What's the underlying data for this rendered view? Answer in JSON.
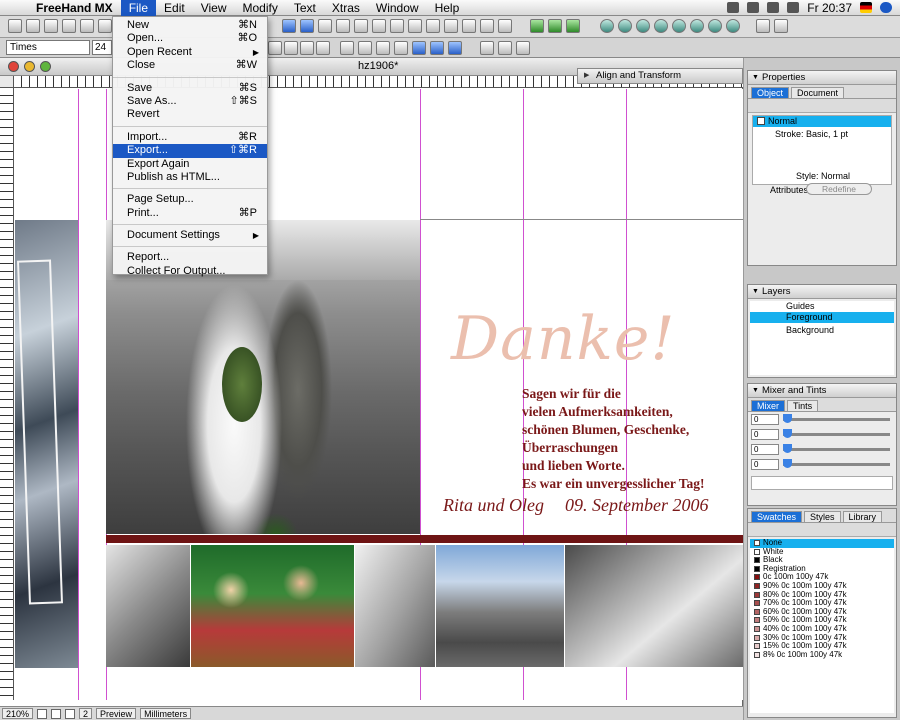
{
  "menubar": {
    "app_name": "FreeHand MX",
    "items": [
      "File",
      "Edit",
      "View",
      "Modify",
      "Text",
      "Xtras",
      "Window",
      "Help"
    ],
    "clock": "Fr 20:37"
  },
  "toolbar": {
    "font": "Times",
    "font_size": "24"
  },
  "document": {
    "title": "hz1906*",
    "zoom": "210%",
    "page": "2",
    "view_mode": "Preview",
    "units": "Millimeters"
  },
  "artwork": {
    "headline": "Danke!",
    "message_lines": [
      "Sagen wir für die",
      "vielen Aufmerksamkeiten,",
      "schönen Blumen, Geschenke,",
      "Überraschungen",
      "und lieben Worte.",
      "Es war ein unvergesslicher Tag!"
    ],
    "signature": "Rita und Oleg",
    "date": "09. September 2006",
    "text_color": "#7a1818",
    "headline_color": "#ebbfae",
    "guide_color": "#d050d0"
  },
  "file_menu": {
    "items": [
      {
        "label": "New",
        "shortcut": "⌘N"
      },
      {
        "label": "Open...",
        "shortcut": "⌘O"
      },
      {
        "label": "Open Recent",
        "submenu": true
      },
      {
        "label": "Close",
        "shortcut": "⌘W"
      },
      {
        "sep": true
      },
      {
        "label": "Save",
        "shortcut": "⌘S"
      },
      {
        "label": "Save As...",
        "shortcut": "⇧⌘S"
      },
      {
        "label": "Revert"
      },
      {
        "sep": true
      },
      {
        "label": "Import...",
        "shortcut": "⌘R"
      },
      {
        "label": "Export...",
        "shortcut": "⇧⌘R",
        "highlighted": true
      },
      {
        "label": "Export Again"
      },
      {
        "label": "Publish as HTML..."
      },
      {
        "sep": true
      },
      {
        "label": "Page Setup..."
      },
      {
        "label": "Print...",
        "shortcut": "⌘P"
      },
      {
        "sep": true
      },
      {
        "label": "Document Settings",
        "submenu": true
      },
      {
        "sep": true
      },
      {
        "label": "Report..."
      },
      {
        "label": "Collect For Output..."
      }
    ]
  },
  "panels": {
    "align": {
      "title": "Align and Transform"
    },
    "properties": {
      "title": "Properties",
      "tabs": [
        "Object",
        "Document"
      ],
      "rows": [
        "Normal",
        "Stroke: Basic, 1 pt"
      ],
      "style_label": "Style:",
      "style_value": "Normal",
      "attributes_label": "Attributes:",
      "redefine": "Redefine"
    },
    "layers": {
      "title": "Layers",
      "items": [
        "Guides",
        "Foreground",
        "Background"
      ]
    },
    "mixer": {
      "title": "Mixer and Tints",
      "tabs": [
        "Mixer",
        "Tints"
      ],
      "values": [
        "0",
        "0",
        "0",
        "0"
      ]
    },
    "swatches": {
      "tabs": [
        "Swatches",
        "Styles",
        "Library"
      ],
      "items": [
        {
          "name": "None",
          "color": "#ffffff"
        },
        {
          "name": "White",
          "color": "#ffffff"
        },
        {
          "name": "Black",
          "color": "#000000"
        },
        {
          "name": "Registration",
          "color": "#000000"
        },
        {
          "name": "0c 100m 100y 47k",
          "color": "#871010"
        },
        {
          "name": "90% 0c 100m 100y 47k",
          "color": "#902424"
        },
        {
          "name": "80% 0c 100m 100y 47k",
          "color": "#9c3939"
        },
        {
          "name": "70% 0c 100m 100y 47k",
          "color": "#a84f4f"
        },
        {
          "name": "60% 0c 100m 100y 47k",
          "color": "#b46565"
        },
        {
          "name": "50% 0c 100m 100y 47k",
          "color": "#c07b7b"
        },
        {
          "name": "40% 0c 100m 100y 47k",
          "color": "#cb9292"
        },
        {
          "name": "30% 0c 100m 100y 47k",
          "color": "#d7a9a9"
        },
        {
          "name": "15% 0c 100m 100y 47k",
          "color": "#e8cccc"
        },
        {
          "name": "8% 0c 100m 100y 47k",
          "color": "#f2e2e2"
        }
      ]
    }
  }
}
